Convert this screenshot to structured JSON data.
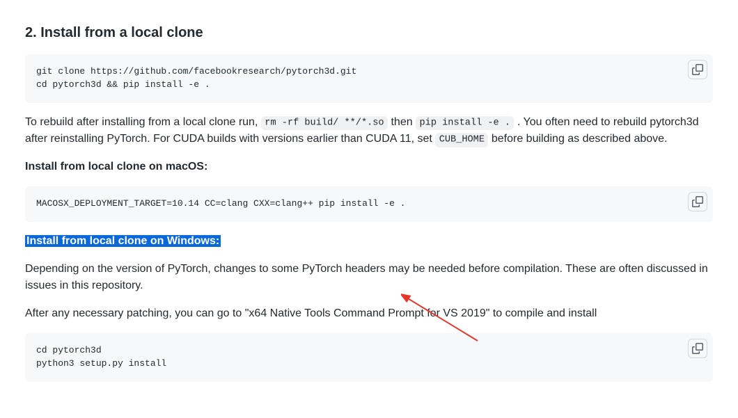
{
  "heading": "2. Install from a local clone",
  "code_blocks": {
    "git": "git clone https://github.com/facebookresearch/pytorch3d.git\ncd pytorch3d && pip install -e .",
    "macos": "MACOSX_DEPLOYMENT_TARGET=10.14 CC=clang CXX=clang++ pip install -e .",
    "windows": "cd pytorch3d\npython3 setup.py install"
  },
  "paragraphs": {
    "rebuild_a": "To rebuild after installing from a local clone run, ",
    "rebuild_code1": "rm -rf build/ **/*.so",
    "rebuild_b": " then ",
    "rebuild_code2": "pip install -e .",
    "rebuild_c": " . You often need to rebuild pytorch3d after reinstalling PyTorch. For CUDA builds with versions earlier than CUDA 11, set ",
    "rebuild_code3": "CUB_HOME",
    "rebuild_d": " before building as described above.",
    "macos_title": "Install from local clone on macOS:",
    "windows_title": "Install from local clone on Windows:",
    "windows_p1": "Depending on the version of PyTorch, changes to some PyTorch headers may be needed before compilation. These are often discussed in issues in this repository.",
    "windows_p2": "After any necessary patching, you can go to \"x64 Native Tools Command Prompt for VS 2019\" to compile and install"
  }
}
